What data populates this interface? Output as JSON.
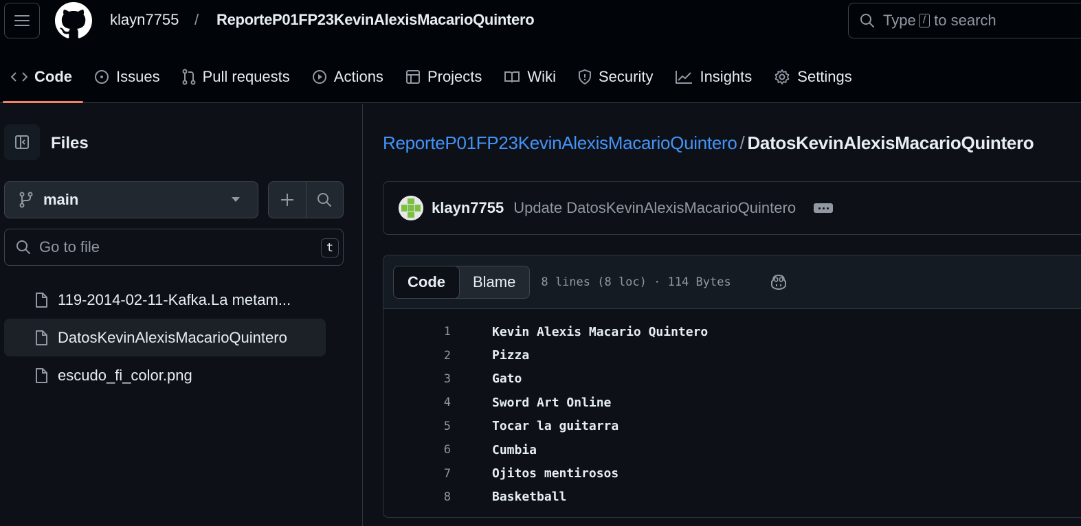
{
  "header": {
    "owner": "klayn7755",
    "separator": "/",
    "repo": "ReporteP01FP23KevinAlexisMacarioQuintero",
    "search": {
      "before": "Type",
      "key": "/",
      "after": "to search"
    }
  },
  "repo_nav": {
    "items": [
      {
        "label": "Code",
        "icon": "code-icon",
        "active": true
      },
      {
        "label": "Issues",
        "icon": "issue-opened-icon"
      },
      {
        "label": "Pull requests",
        "icon": "git-pull-request-icon"
      },
      {
        "label": "Actions",
        "icon": "play-icon"
      },
      {
        "label": "Projects",
        "icon": "table-icon"
      },
      {
        "label": "Wiki",
        "icon": "book-icon"
      },
      {
        "label": "Security",
        "icon": "shield-icon"
      },
      {
        "label": "Insights",
        "icon": "graph-icon"
      },
      {
        "label": "Settings",
        "icon": "gear-icon"
      }
    ]
  },
  "sidebar": {
    "title": "Files",
    "branch": "main",
    "goto_placeholder": "Go to file",
    "goto_shortcut": "t",
    "files": [
      {
        "name": "119-2014-02-11-Kafka.La metam...",
        "selected": false
      },
      {
        "name": "DatosKevinAlexisMacarioQuintero",
        "selected": true
      },
      {
        "name": "escudo_fi_color.png",
        "selected": false
      }
    ]
  },
  "main": {
    "path": {
      "repo": "ReporteP01FP23KevinAlexisMacarioQuintero",
      "separator": "/",
      "file": "DatosKevinAlexisMacarioQuintero"
    },
    "commit": {
      "author": "klayn7755",
      "message": "Update DatosKevinAlexisMacarioQuintero"
    },
    "code_tabs": {
      "code": "Code",
      "blame": "Blame"
    },
    "file_meta": "8 lines (8 loc) · 114 Bytes",
    "lines": [
      {
        "n": "1",
        "text": "Kevin Alexis Macario Quintero"
      },
      {
        "n": "2",
        "text": "Pizza"
      },
      {
        "n": "3",
        "text": "Gato"
      },
      {
        "n": "4",
        "text": "Sword Art Online"
      },
      {
        "n": "5",
        "text": "Tocar la guitarra"
      },
      {
        "n": "6",
        "text": "Cumbia"
      },
      {
        "n": "7",
        "text": "Ojitos mentirosos"
      },
      {
        "n": "8",
        "text": "Basketball"
      }
    ]
  },
  "colors": {
    "accent_link": "#4493f8",
    "active_underline": "#f78166",
    "background": "#0d1117"
  }
}
